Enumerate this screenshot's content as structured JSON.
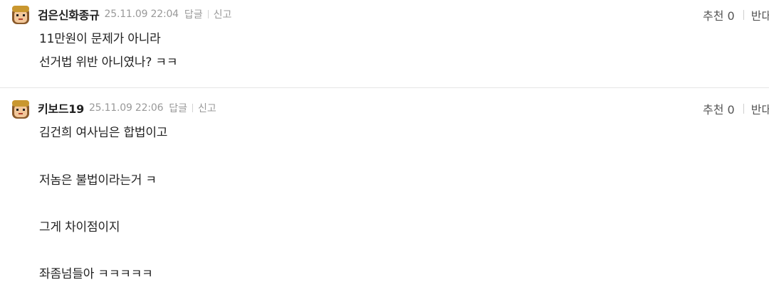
{
  "comments": [
    {
      "nickname": "검은신화종규",
      "date": "25.11.09 22:04",
      "reply_label": "답글",
      "report_label": "신고",
      "recommend_label": "추천 0",
      "oppose_label": "반대",
      "lines": [
        "11만원이 문제가 아니라",
        "선거법 위반 아니였나? ㅋㅋ"
      ]
    },
    {
      "nickname": "키보드19",
      "date": "25.11.09 22:06",
      "reply_label": "답글",
      "report_label": "신고",
      "recommend_label": "추천 0",
      "oppose_label": "반대",
      "lines": [
        "김건희 여사님은 합법이고",
        "저놈은 불법이라는거 ㅋ",
        "그게 차이점이지",
        "좌좀넘들아 ㅋㅋㅋㅋㅋ"
      ]
    }
  ]
}
